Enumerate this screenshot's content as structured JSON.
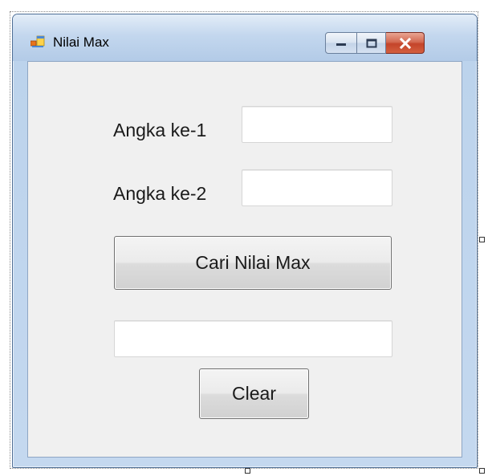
{
  "window": {
    "title": "Nilai Max",
    "controls": {
      "minimize_icon": "minimize-icon",
      "maximize_icon": "maximize-icon",
      "close_icon": "close-icon"
    }
  },
  "form": {
    "label_1": "Angka ke-1",
    "input_1_value": "",
    "label_2": "Angka ke-2",
    "input_2_value": "",
    "find_max_button": "Cari Nilai Max",
    "result_value": "",
    "clear_button": "Clear"
  },
  "colors": {
    "close_button": "#c4442a",
    "client_background": "#f0f0f0",
    "frame": "#b7cfea"
  }
}
